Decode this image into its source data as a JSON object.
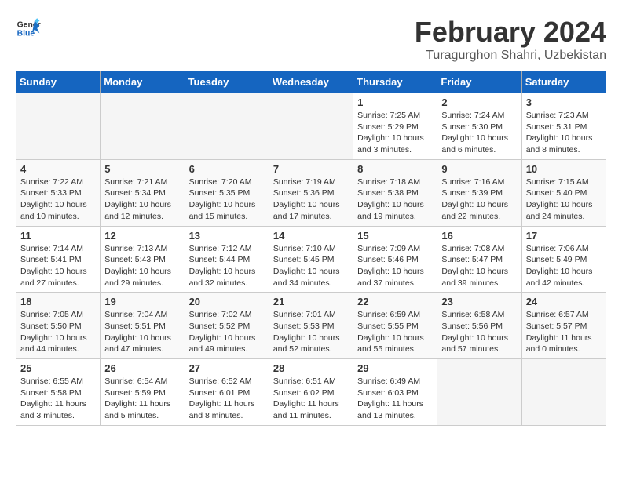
{
  "header": {
    "logo_general": "General",
    "logo_blue": "Blue",
    "title": "February 2024",
    "subtitle": "Turagurghon Shahri, Uzbekistan"
  },
  "columns": [
    "Sunday",
    "Monday",
    "Tuesday",
    "Wednesday",
    "Thursday",
    "Friday",
    "Saturday"
  ],
  "weeks": [
    [
      {
        "day": "",
        "info": ""
      },
      {
        "day": "",
        "info": ""
      },
      {
        "day": "",
        "info": ""
      },
      {
        "day": "",
        "info": ""
      },
      {
        "day": "1",
        "info": "Sunrise: 7:25 AM\nSunset: 5:29 PM\nDaylight: 10 hours\nand 3 minutes."
      },
      {
        "day": "2",
        "info": "Sunrise: 7:24 AM\nSunset: 5:30 PM\nDaylight: 10 hours\nand 6 minutes."
      },
      {
        "day": "3",
        "info": "Sunrise: 7:23 AM\nSunset: 5:31 PM\nDaylight: 10 hours\nand 8 minutes."
      }
    ],
    [
      {
        "day": "4",
        "info": "Sunrise: 7:22 AM\nSunset: 5:33 PM\nDaylight: 10 hours\nand 10 minutes."
      },
      {
        "day": "5",
        "info": "Sunrise: 7:21 AM\nSunset: 5:34 PM\nDaylight: 10 hours\nand 12 minutes."
      },
      {
        "day": "6",
        "info": "Sunrise: 7:20 AM\nSunset: 5:35 PM\nDaylight: 10 hours\nand 15 minutes."
      },
      {
        "day": "7",
        "info": "Sunrise: 7:19 AM\nSunset: 5:36 PM\nDaylight: 10 hours\nand 17 minutes."
      },
      {
        "day": "8",
        "info": "Sunrise: 7:18 AM\nSunset: 5:38 PM\nDaylight: 10 hours\nand 19 minutes."
      },
      {
        "day": "9",
        "info": "Sunrise: 7:16 AM\nSunset: 5:39 PM\nDaylight: 10 hours\nand 22 minutes."
      },
      {
        "day": "10",
        "info": "Sunrise: 7:15 AM\nSunset: 5:40 PM\nDaylight: 10 hours\nand 24 minutes."
      }
    ],
    [
      {
        "day": "11",
        "info": "Sunrise: 7:14 AM\nSunset: 5:41 PM\nDaylight: 10 hours\nand 27 minutes."
      },
      {
        "day": "12",
        "info": "Sunrise: 7:13 AM\nSunset: 5:43 PM\nDaylight: 10 hours\nand 29 minutes."
      },
      {
        "day": "13",
        "info": "Sunrise: 7:12 AM\nSunset: 5:44 PM\nDaylight: 10 hours\nand 32 minutes."
      },
      {
        "day": "14",
        "info": "Sunrise: 7:10 AM\nSunset: 5:45 PM\nDaylight: 10 hours\nand 34 minutes."
      },
      {
        "day": "15",
        "info": "Sunrise: 7:09 AM\nSunset: 5:46 PM\nDaylight: 10 hours\nand 37 minutes."
      },
      {
        "day": "16",
        "info": "Sunrise: 7:08 AM\nSunset: 5:47 PM\nDaylight: 10 hours\nand 39 minutes."
      },
      {
        "day": "17",
        "info": "Sunrise: 7:06 AM\nSunset: 5:49 PM\nDaylight: 10 hours\nand 42 minutes."
      }
    ],
    [
      {
        "day": "18",
        "info": "Sunrise: 7:05 AM\nSunset: 5:50 PM\nDaylight: 10 hours\nand 44 minutes."
      },
      {
        "day": "19",
        "info": "Sunrise: 7:04 AM\nSunset: 5:51 PM\nDaylight: 10 hours\nand 47 minutes."
      },
      {
        "day": "20",
        "info": "Sunrise: 7:02 AM\nSunset: 5:52 PM\nDaylight: 10 hours\nand 49 minutes."
      },
      {
        "day": "21",
        "info": "Sunrise: 7:01 AM\nSunset: 5:53 PM\nDaylight: 10 hours\nand 52 minutes."
      },
      {
        "day": "22",
        "info": "Sunrise: 6:59 AM\nSunset: 5:55 PM\nDaylight: 10 hours\nand 55 minutes."
      },
      {
        "day": "23",
        "info": "Sunrise: 6:58 AM\nSunset: 5:56 PM\nDaylight: 10 hours\nand 57 minutes."
      },
      {
        "day": "24",
        "info": "Sunrise: 6:57 AM\nSunset: 5:57 PM\nDaylight: 11 hours\nand 0 minutes."
      }
    ],
    [
      {
        "day": "25",
        "info": "Sunrise: 6:55 AM\nSunset: 5:58 PM\nDaylight: 11 hours\nand 3 minutes."
      },
      {
        "day": "26",
        "info": "Sunrise: 6:54 AM\nSunset: 5:59 PM\nDaylight: 11 hours\nand 5 minutes."
      },
      {
        "day": "27",
        "info": "Sunrise: 6:52 AM\nSunset: 6:01 PM\nDaylight: 11 hours\nand 8 minutes."
      },
      {
        "day": "28",
        "info": "Sunrise: 6:51 AM\nSunset: 6:02 PM\nDaylight: 11 hours\nand 11 minutes."
      },
      {
        "day": "29",
        "info": "Sunrise: 6:49 AM\nSunset: 6:03 PM\nDaylight: 11 hours\nand 13 minutes."
      },
      {
        "day": "",
        "info": ""
      },
      {
        "day": "",
        "info": ""
      }
    ]
  ]
}
